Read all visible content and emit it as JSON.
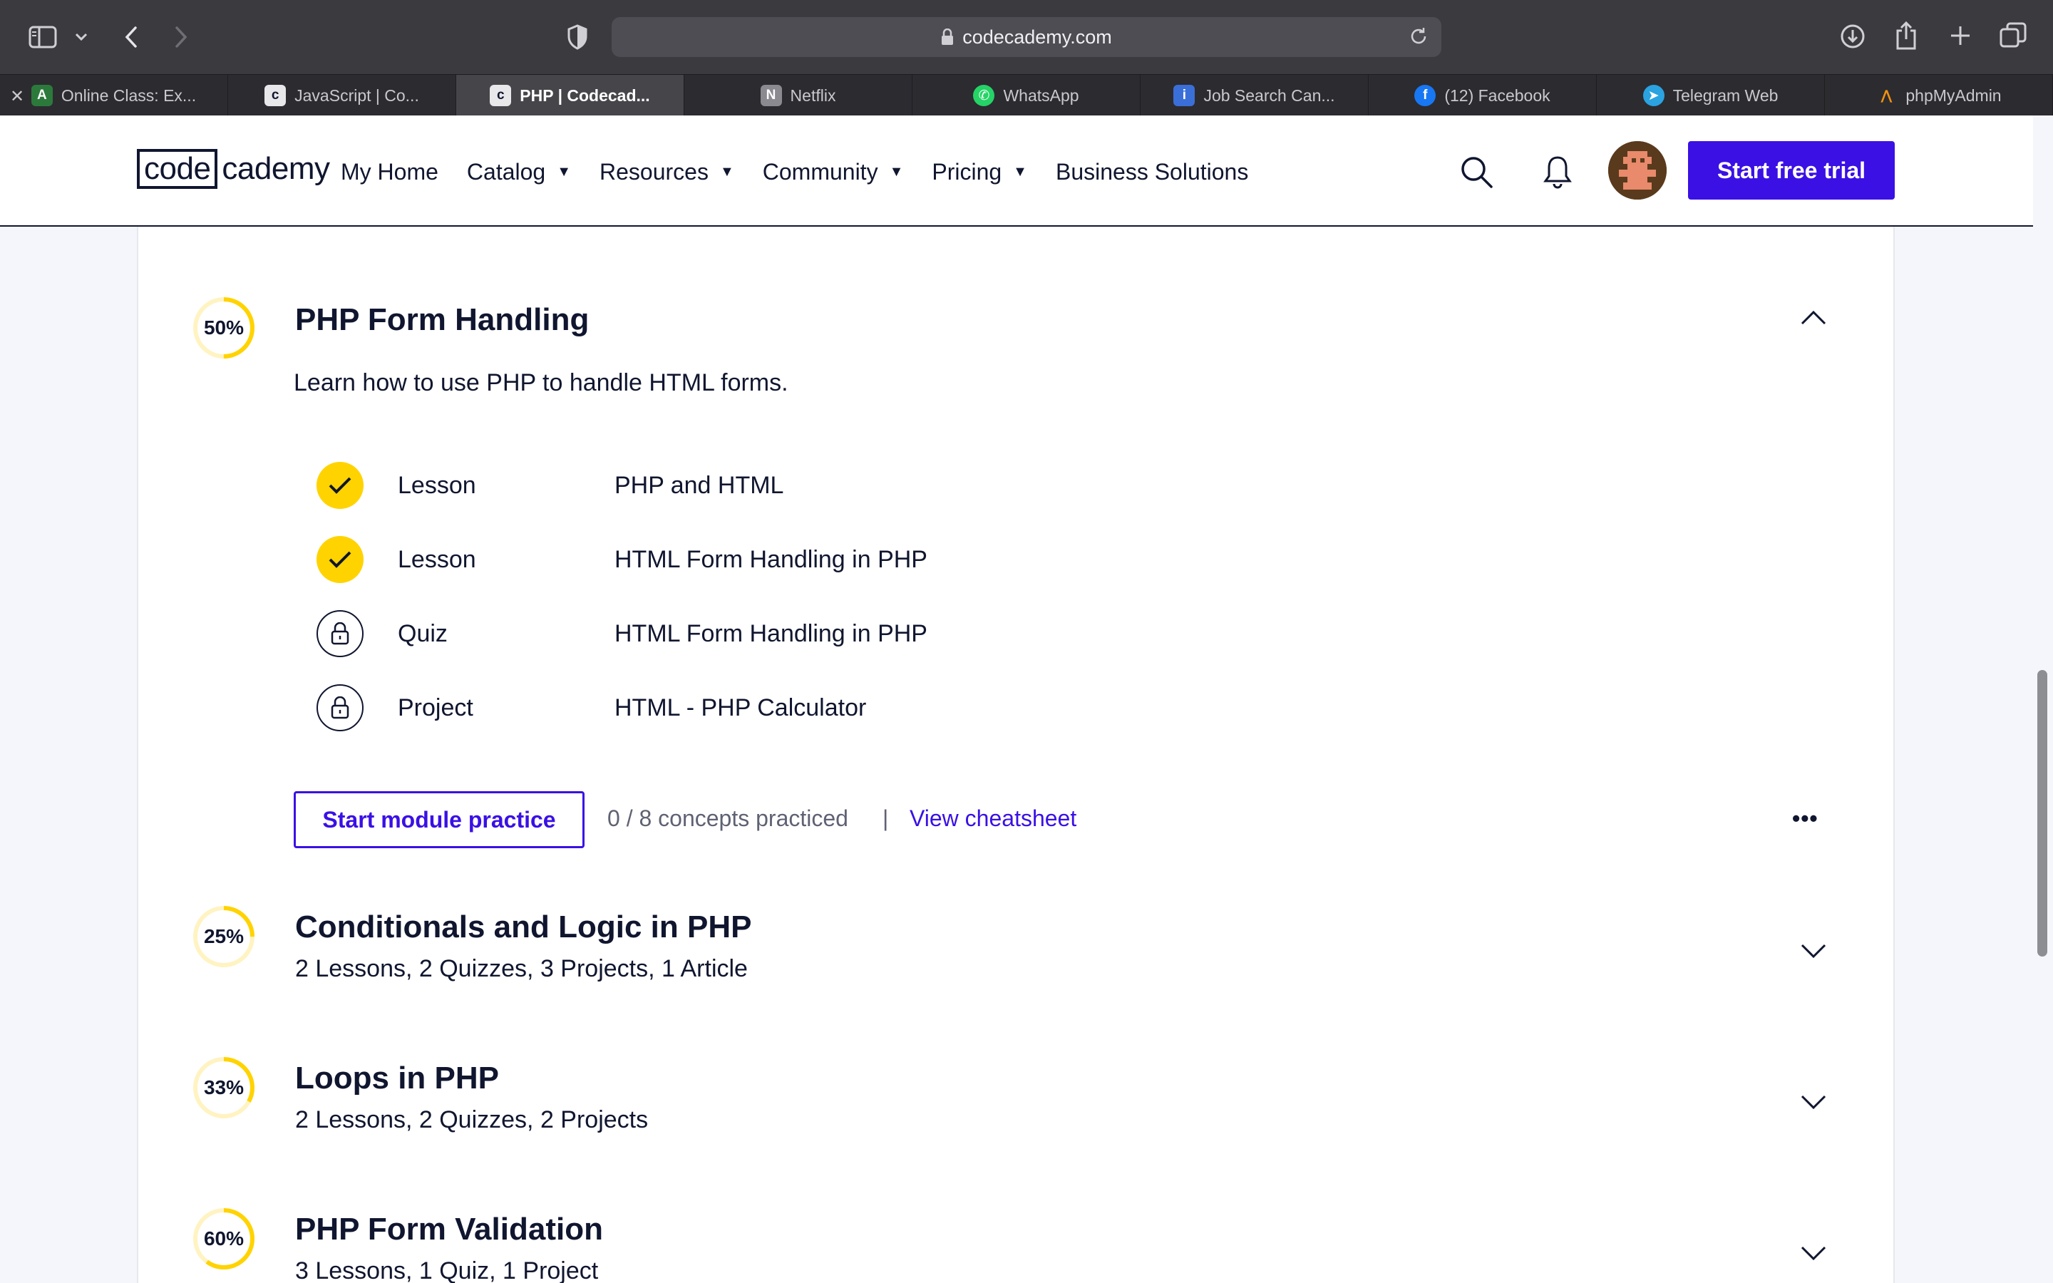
{
  "browser": {
    "url": "codecademy.com",
    "tabs": [
      {
        "title": "Online Class: Ex...",
        "icon": "online-class-icon",
        "active": false,
        "closable": true
      },
      {
        "title": "JavaScript | Co...",
        "icon": "codecademy-icon",
        "active": false
      },
      {
        "title": "PHP | Codecad...",
        "icon": "codecademy-icon",
        "active": true
      },
      {
        "title": "Netflix",
        "icon": "netflix-icon",
        "active": false
      },
      {
        "title": "WhatsApp",
        "icon": "whatsapp-icon",
        "active": false
      },
      {
        "title": "Job Search Can...",
        "icon": "info-icon",
        "active": false
      },
      {
        "title": "(12) Facebook",
        "icon": "facebook-icon",
        "active": false
      },
      {
        "title": "Telegram Web",
        "icon": "telegram-icon",
        "active": false
      },
      {
        "title": "phpMyAdmin",
        "icon": "phpmyadmin-icon",
        "active": false
      }
    ]
  },
  "header": {
    "logo_code": "code",
    "logo_rest": "cademy",
    "nav": [
      {
        "label": "My Home",
        "dropdown": false
      },
      {
        "label": "Catalog",
        "dropdown": true
      },
      {
        "label": "Resources",
        "dropdown": true
      },
      {
        "label": "Community",
        "dropdown": true
      },
      {
        "label": "Pricing",
        "dropdown": true
      },
      {
        "label": "Business Solutions",
        "dropdown": false
      }
    ],
    "cta": "Start free trial"
  },
  "colors": {
    "brand": "#3a10e5",
    "progress": "#ffd300",
    "text": "#10162f"
  },
  "modules": [
    {
      "progress": "50%",
      "progress_value": 0.5,
      "title": "PHP Form Handling",
      "description": "Learn how to use PHP to handle HTML forms.",
      "expanded": true,
      "items": [
        {
          "type": "Lesson",
          "name": "PHP and HTML",
          "status": "done"
        },
        {
          "type": "Lesson",
          "name": "HTML Form Handling in PHP",
          "status": "done"
        },
        {
          "type": "Quiz",
          "name": "HTML Form Handling in PHP",
          "status": "locked"
        },
        {
          "type": "Project",
          "name": "HTML - PHP Calculator",
          "status": "locked"
        }
      ],
      "practice_button": "Start module practice",
      "concepts": "0 / 8 concepts practiced",
      "separator": "|",
      "cheatsheet": "View cheatsheet",
      "more": "•••"
    },
    {
      "progress": "25%",
      "progress_value": 0.25,
      "title": "Conditionals and Logic in PHP",
      "summary": "2 Lessons, 2 Quizzes, 3 Projects, 1 Article",
      "expanded": false
    },
    {
      "progress": "33%",
      "progress_value": 0.33,
      "title": "Loops in PHP",
      "summary": "2 Lessons, 2 Quizzes, 2 Projects",
      "expanded": false
    },
    {
      "progress": "60%",
      "progress_value": 0.6,
      "title": "PHP Form Validation",
      "summary": "3 Lessons, 1 Quiz, 1 Project",
      "expanded": false
    }
  ]
}
